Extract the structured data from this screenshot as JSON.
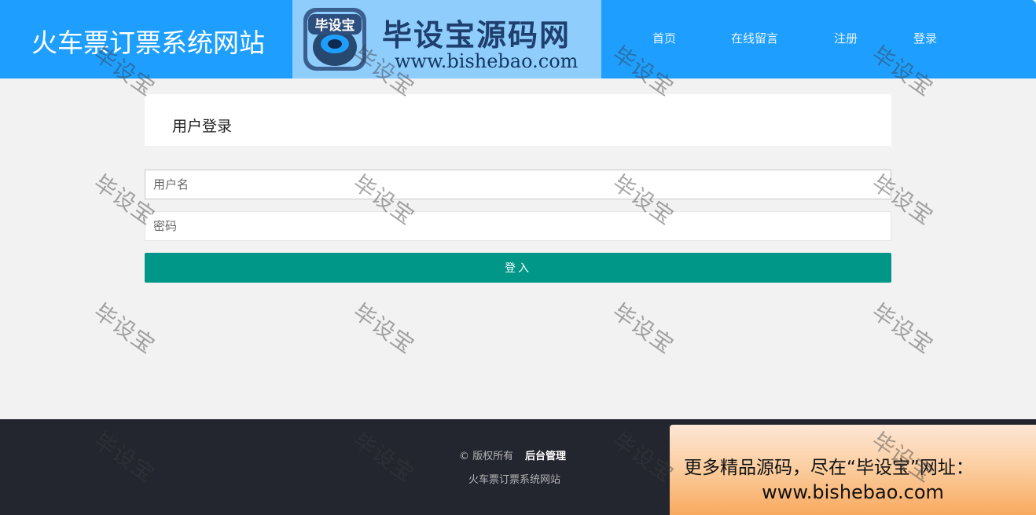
{
  "header": {
    "site_title": "火车票订票系统网站",
    "logo_badge_text": "毕设宝",
    "logo_main": "毕设宝源码网",
    "logo_url": "www.bishebao.com",
    "nav": [
      "首页",
      "在线留言",
      "注册",
      "登录"
    ]
  },
  "login": {
    "title": "用户登录",
    "username_placeholder": "用户名",
    "password_placeholder": "密码",
    "submit_label": "登入"
  },
  "footer": {
    "copyright": "© 版权所有",
    "admin_link": "后台管理",
    "site_name": "火车票订票系统网站"
  },
  "promo": {
    "line1": "更多精品源码，尽在“毕设宝”网址：",
    "line2": "www.bishebao.com"
  },
  "watermark": "毕设宝",
  "colors": {
    "header_bg": "#1e9fff",
    "button_bg": "#009688",
    "footer_bg": "#23262e",
    "page_bg": "#f2f2f2"
  }
}
